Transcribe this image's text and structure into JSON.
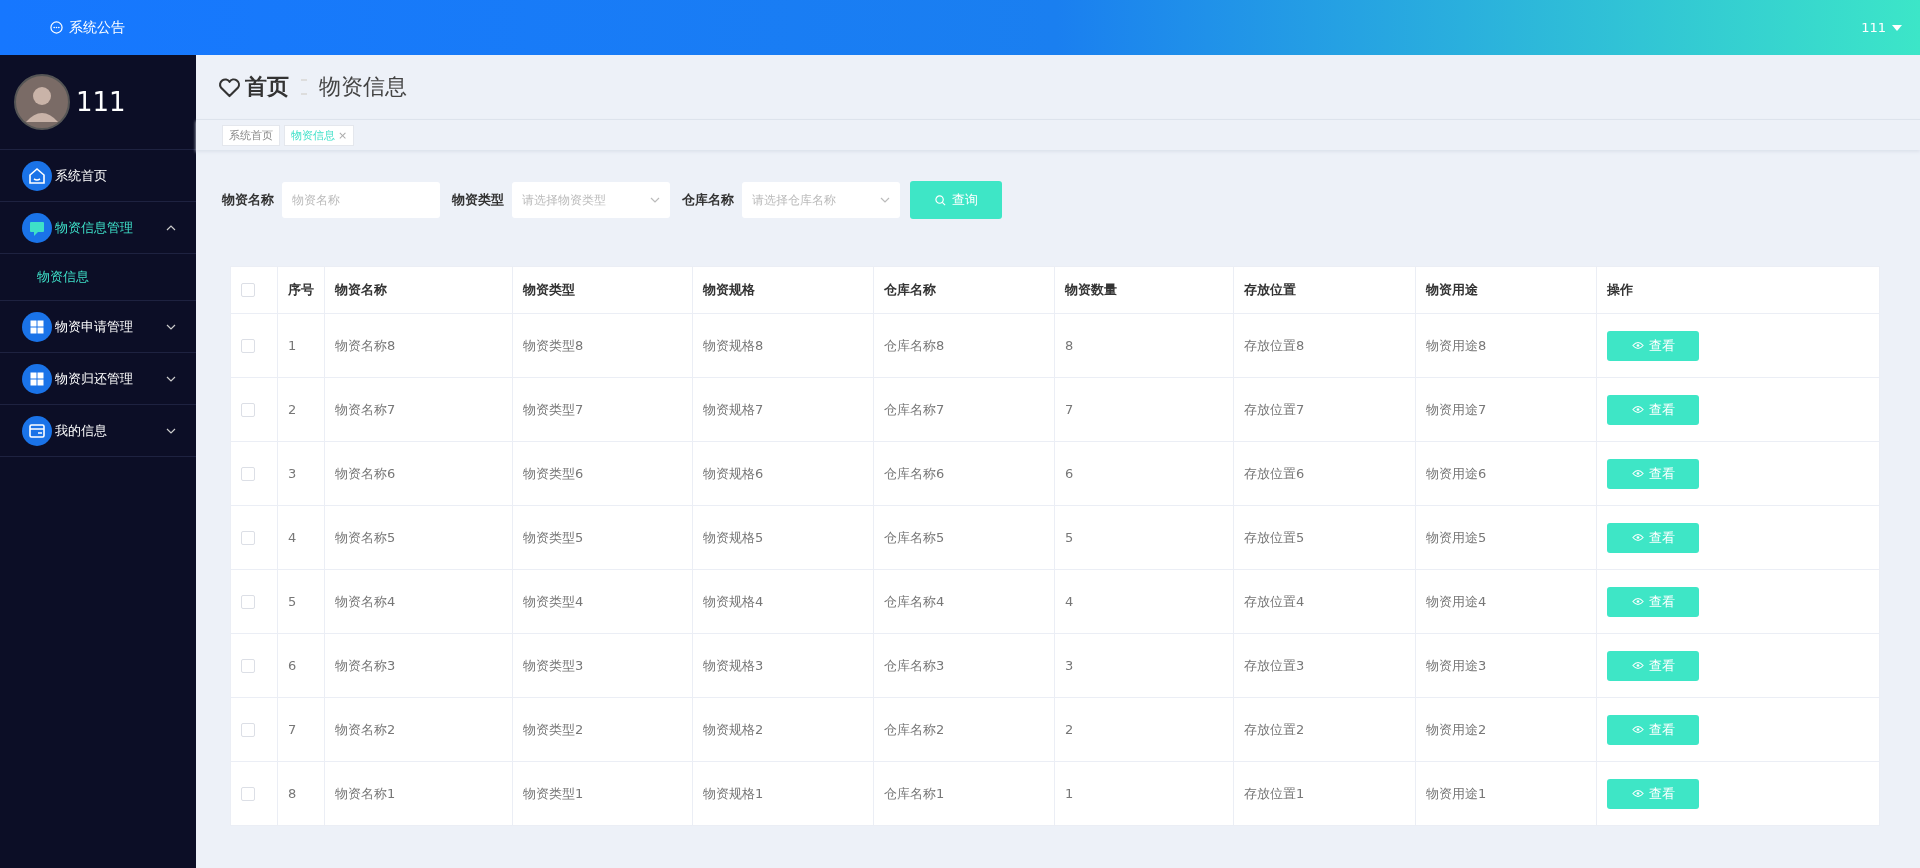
{
  "header": {
    "notice": "系统公告",
    "user": "111"
  },
  "sidebar": {
    "username": "111",
    "items": [
      {
        "label": "系统首页",
        "selected": false
      },
      {
        "label": "物资信息管理",
        "expanded": true,
        "selected": true,
        "children": [
          {
            "label": "物资信息",
            "selected": true
          }
        ]
      },
      {
        "label": "物资申请管理",
        "expanded": false,
        "selected": false
      },
      {
        "label": "物资归还管理",
        "expanded": false,
        "selected": false
      },
      {
        "label": "我的信息",
        "expanded": false,
        "selected": false
      }
    ]
  },
  "breadcrumb": {
    "home": "首页",
    "current": "物资信息"
  },
  "tabs": [
    {
      "label": "系统首页",
      "selected": false
    },
    {
      "label": "物资信息",
      "selected": true,
      "close": "×"
    }
  ],
  "filters": [
    {
      "label": "物资名称",
      "kind": "input",
      "placeholder": "物资名称"
    },
    {
      "label": "物资类型",
      "kind": "select",
      "placeholder": "请选择物资类型"
    },
    {
      "label": "仓库名称",
      "kind": "select",
      "placeholder": "请选择仓库名称"
    }
  ],
  "search_button": "查询",
  "table": {
    "select_all_checked": false,
    "columns": [
      "序号",
      "物资名称",
      "物资类型",
      "物资规格",
      "仓库名称",
      "物资数量",
      "存放位置",
      "物资用途",
      "操作"
    ],
    "rows": [
      {
        "cells": [
          "1",
          "物资名称8",
          "物资类型8",
          "物资规格8",
          "仓库名称8",
          "8",
          "存放位置8",
          "物资用途8"
        ],
        "checked": false,
        "action": "查看"
      },
      {
        "cells": [
          "2",
          "物资名称7",
          "物资类型7",
          "物资规格7",
          "仓库名称7",
          "7",
          "存放位置7",
          "物资用途7"
        ],
        "checked": false,
        "action": "查看"
      },
      {
        "cells": [
          "3",
          "物资名称6",
          "物资类型6",
          "物资规格6",
          "仓库名称6",
          "6",
          "存放位置6",
          "物资用途6"
        ],
        "checked": false,
        "action": "查看"
      },
      {
        "cells": [
          "4",
          "物资名称5",
          "物资类型5",
          "物资规格5",
          "仓库名称5",
          "5",
          "存放位置5",
          "物资用途5"
        ],
        "checked": false,
        "action": "查看"
      },
      {
        "cells": [
          "5",
          "物资名称4",
          "物资类型4",
          "物资规格4",
          "仓库名称4",
          "4",
          "存放位置4",
          "物资用途4"
        ],
        "checked": false,
        "action": "查看"
      },
      {
        "cells": [
          "6",
          "物资名称3",
          "物资类型3",
          "物资规格3",
          "仓库名称3",
          "3",
          "存放位置3",
          "物资用途3"
        ],
        "checked": false,
        "action": "查看"
      },
      {
        "cells": [
          "7",
          "物资名称2",
          "物资类型2",
          "物资规格2",
          "仓库名称2",
          "2",
          "存放位置2",
          "物资用途2"
        ],
        "checked": false,
        "action": "查看"
      },
      {
        "cells": [
          "8",
          "物资名称1",
          "物资类型1",
          "物资规格1",
          "仓库名称1",
          "1",
          "存放位置1",
          "物资用途1"
        ],
        "checked": false,
        "action": "查看"
      }
    ]
  }
}
